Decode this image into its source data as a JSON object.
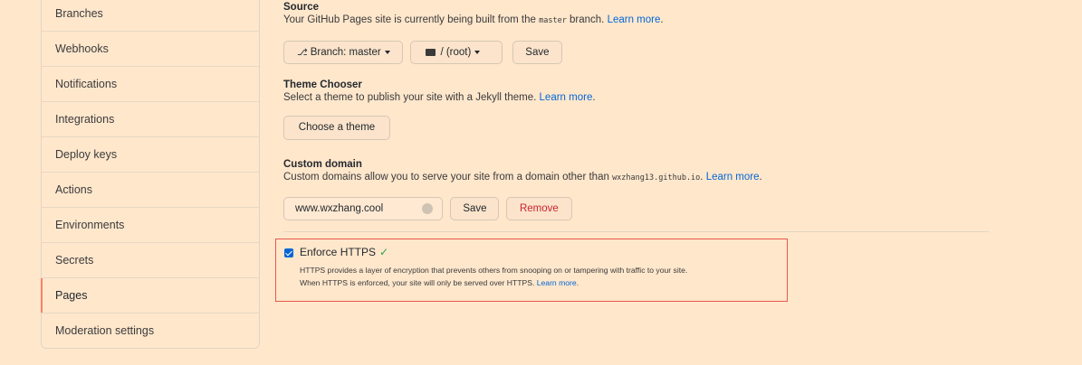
{
  "sidebar": {
    "items": [
      {
        "label": ""
      },
      {
        "label": "Branches"
      },
      {
        "label": "Webhooks"
      },
      {
        "label": "Notifications"
      },
      {
        "label": "Integrations"
      },
      {
        "label": "Deploy keys"
      },
      {
        "label": "Actions"
      },
      {
        "label": "Environments"
      },
      {
        "label": "Secrets"
      },
      {
        "label": "Pages",
        "active": true
      },
      {
        "label": "Moderation settings"
      }
    ]
  },
  "source": {
    "title": "Source",
    "desc_before": "Your GitHub Pages site is currently being built from the ",
    "branch_code": "master",
    "desc_after": " branch. ",
    "learn_more": "Learn more",
    "branch_button": "Branch: master",
    "folder_button": "/ (root)",
    "save_button": "Save"
  },
  "theme": {
    "title": "Theme Chooser",
    "desc": "Select a theme to publish your site with a Jekyll theme. ",
    "learn_more": "Learn more",
    "button": "Choose a theme"
  },
  "domain": {
    "title": "Custom domain",
    "desc_before": "Custom domains allow you to serve your site from a domain other than ",
    "domain_code": "wxzhang13.github.io",
    "desc_after": ". ",
    "learn_more": "Learn more",
    "value": "www.wxzhang.cool",
    "save_button": "Save",
    "remove_button": "Remove"
  },
  "https": {
    "label": "Enforce HTTPS",
    "checked": true,
    "line1": "HTTPS provides a layer of encryption that prevents others from snooping on or tampering with traffic to your site.",
    "line2": "When HTTPS is enforced, your site will only be served over HTTPS. ",
    "learn_more": "Learn more"
  },
  "colors": {
    "background": "#ffe7cc",
    "link": "#0366d6",
    "active_marker": "#f9826c",
    "highlight_border": "#e8584d",
    "remove_text": "#cb2431",
    "check_green": "#28a745"
  }
}
